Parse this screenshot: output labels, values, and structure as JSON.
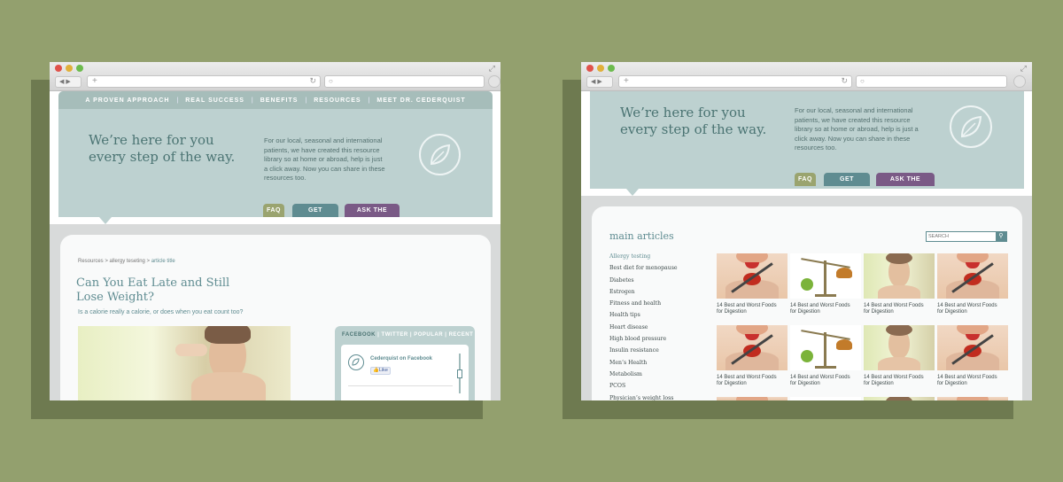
{
  "left": {
    "nav": [
      "A PROVEN APPROACH",
      "REAL SUCCESS",
      "BENEFITS",
      "RESOURCES",
      "MEET DR. CEDERQUIST"
    ],
    "tagline": [
      "We’re here for you",
      "every step of the way."
    ],
    "blurb": "For our local, seasonal and international patients, we have created this resource library so at home or abroad, help is just a click away. Now you can share in these resources too.",
    "tabs": [
      "FAQ",
      "GET STARTED",
      "ASK THE DOCTOR"
    ],
    "breadcrumb": {
      "a": "Resources",
      "sep1": " > ",
      "b": "allergy teseting",
      "sep2": " > ",
      "c": "article title"
    },
    "title": [
      "Can You Eat Late and Still",
      "Lose Weight?"
    ],
    "subtitle": "Is a calorie really a calorie, or does when you eat count too?",
    "social_tabs": [
      "FACEBOOK",
      "TWITTER",
      "POPULAR",
      "RECENT"
    ],
    "fb_name": "Cederquist on Facebook",
    "fb_like": "Like"
  },
  "right": {
    "tagline": [
      "We’re here for you",
      "every step of the way."
    ],
    "blurb": "For our local, seasonal and international patients, we have created this resource library so at home or abroad, help is just a click away. Now you can share in these resources too.",
    "tabs": [
      "FAQ",
      "GET STARTED",
      "ASK THE DOCTOR"
    ],
    "section_title": "main articles",
    "search_placeholder": "SEARCH",
    "articles": [
      "Allergy testing",
      "Best diet for menopause",
      "Diabetes",
      "Estrogen",
      "Fitness and health",
      "Health tips",
      "Heart disease",
      "High blood pressure",
      "Insulin resistance",
      "Men’s Health",
      "Metabolism",
      "PCOS",
      "Physician’s weight loss"
    ],
    "thumb_caption_line1": "14 Best and Worst Foods",
    "thumb_caption_line2": "for Digestion"
  },
  "colors": {
    "accent": "#5f8c91",
    "hero": "#bdd1d0",
    "faq": "#9aa46f",
    "ask": "#7a5a86",
    "bg": "#93a06e"
  }
}
